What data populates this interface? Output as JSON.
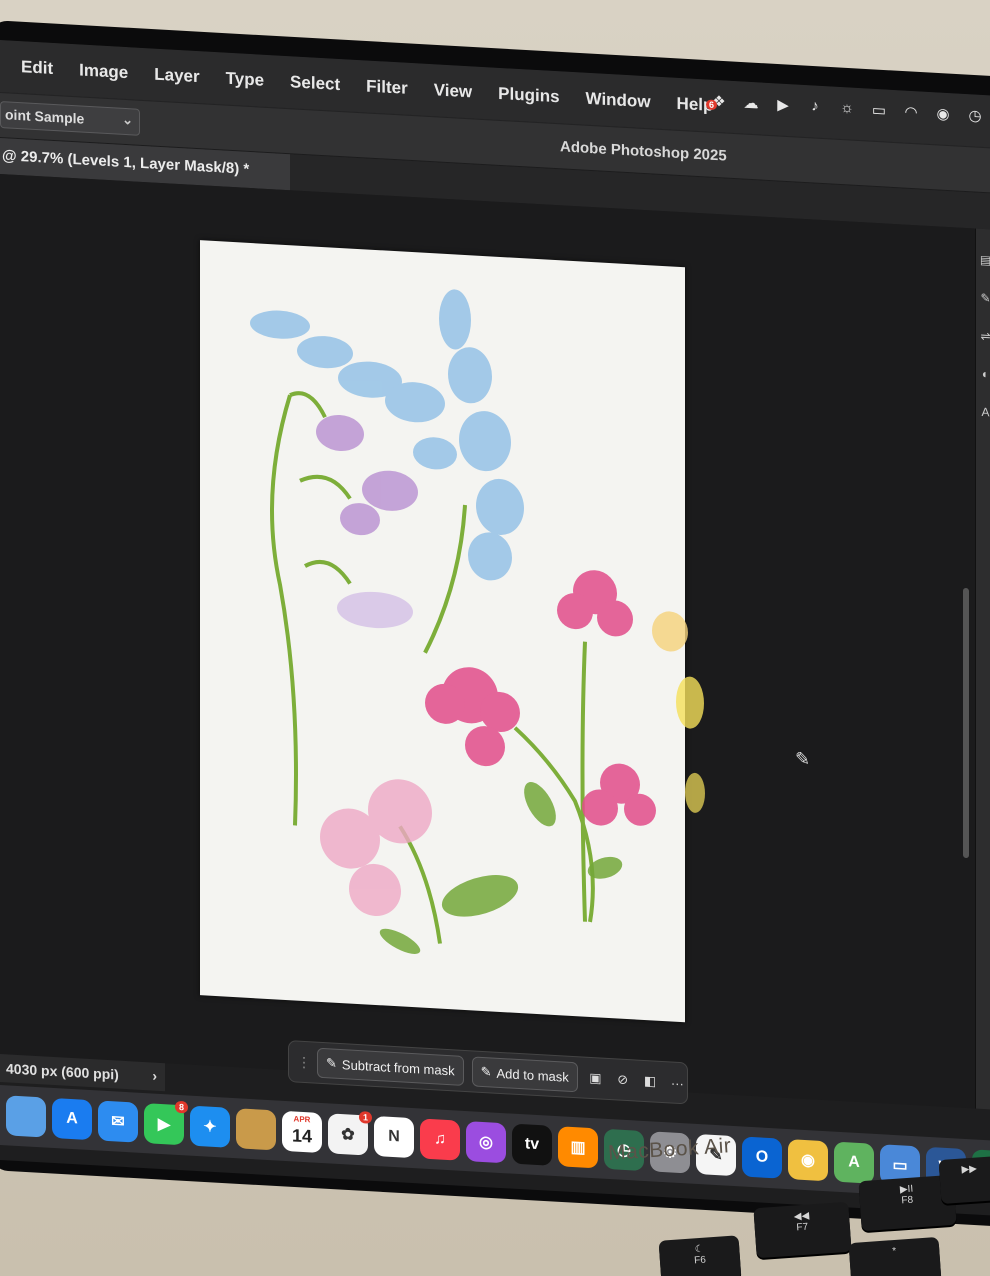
{
  "menu": {
    "items": [
      "Edit",
      "Image",
      "Layer",
      "Type",
      "Select",
      "Filter",
      "View",
      "Plugins",
      "Window",
      "Help"
    ],
    "status_badge": "6"
  },
  "options_bar": {
    "sample_select": "oint Sample",
    "app_title": "Adobe Photoshop 2025"
  },
  "document": {
    "tab_label": "@ 29.7% (Levels 1, Layer Mask/8) *"
  },
  "context_bar": {
    "subtract_label": "Subtract from mask",
    "add_label": "Add to mask",
    "more_label": "···"
  },
  "status_bar": {
    "text": "4030 px (600 ppi)",
    "chevron": "›"
  },
  "dock": {
    "apps": [
      {
        "name": "finder",
        "label": "",
        "color": "#5aa0e6"
      },
      {
        "name": "app-store",
        "label": "A",
        "color": "#1a7cf0"
      },
      {
        "name": "mail",
        "label": "✉",
        "color": "#2d8cf0"
      },
      {
        "name": "facetime",
        "label": "▶",
        "color": "#34c759",
        "badge": "8"
      },
      {
        "name": "safari",
        "label": "✦",
        "color": "#1d8ef0"
      },
      {
        "name": "photo-booth",
        "label": "",
        "color": "#c99a4a"
      },
      {
        "name": "calendar",
        "label": "",
        "color": "#ffffff",
        "month": "APR",
        "day": "14"
      },
      {
        "name": "photos",
        "label": "✿",
        "color": "#f3f3f3",
        "badge": "1"
      },
      {
        "name": "news",
        "label": "N",
        "color": "#ffffff"
      },
      {
        "name": "music",
        "label": "♫",
        "color": "#fa3c4c"
      },
      {
        "name": "podcasts",
        "label": "◎",
        "color": "#9b4de0"
      },
      {
        "name": "tv",
        "label": "tv",
        "color": "#111111"
      },
      {
        "name": "books",
        "label": "▥",
        "color": "#ff8a00"
      },
      {
        "name": "time-machine",
        "label": "◷",
        "color": "#2e6e4e"
      },
      {
        "name": "system-settings",
        "label": "⚙",
        "color": "#8e8e93"
      },
      {
        "name": "textedit",
        "label": "✎",
        "color": "#f5f5f5"
      },
      {
        "name": "outlook",
        "label": "O",
        "color": "#0a64d2"
      },
      {
        "name": "chrome",
        "label": "◉",
        "color": "#f0c040"
      },
      {
        "name": "maps",
        "label": "A",
        "color": "#5fb35f"
      },
      {
        "name": "preview",
        "label": "▭",
        "color": "#4a88d8"
      },
      {
        "name": "word",
        "label": "W",
        "color": "#2b5797"
      },
      {
        "name": "excel",
        "label": "X",
        "color": "#1e7145"
      },
      {
        "name": "monitor",
        "label": "◔",
        "color": "#ececec"
      },
      {
        "name": "powerpoint",
        "label": "▦",
        "color": "#d04423"
      },
      {
        "name": "spotify",
        "label": "◉",
        "color": "#1db954"
      },
      {
        "name": "numbers",
        "label": "▮",
        "color": "#3db84a"
      },
      {
        "name": "messages",
        "label": "●",
        "color": "#34c759"
      }
    ]
  },
  "hardware": {
    "brand": "MacBook Air",
    "keys": [
      {
        "name": "key-f6",
        "glyph": "☾",
        "label": "F6"
      },
      {
        "name": "key-f7",
        "glyph": "◀◀",
        "label": "F7"
      },
      {
        "name": "key-f8",
        "glyph": "▶II",
        "label": "F8"
      },
      {
        "name": "key-f9",
        "glyph": "▶▶",
        "label": ""
      },
      {
        "name": "key-star",
        "glyph": "*",
        "label": ""
      }
    ]
  },
  "colors": {
    "menubar": "#2b2b2c",
    "canvas_bg": "#1b1b1c",
    "artboard": "#f4f4f1"
  }
}
